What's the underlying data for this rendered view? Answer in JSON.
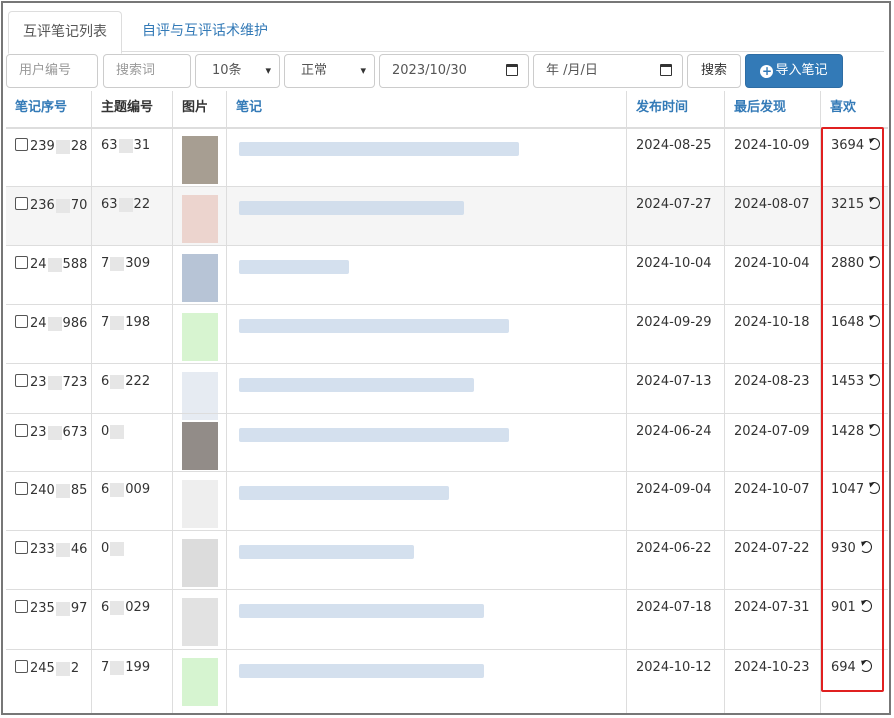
{
  "tabs": [
    {
      "label": "互评笔记列表",
      "active": true
    },
    {
      "label": "自评与互评话术维护",
      "active": false
    }
  ],
  "filters": {
    "user_id_placeholder": "用户编号",
    "keyword_placeholder": "搜索词",
    "page_size": "10条",
    "status": "正常",
    "date_from": "2023/10/30",
    "date_to_placeholder": "年 /月/日",
    "search_label": "搜索",
    "import_label": "导入笔记"
  },
  "columns": [
    "笔记序号",
    "主题编号",
    "图片",
    "笔记",
    "发布时间",
    "最后发现",
    "喜欢"
  ],
  "rows": [
    {
      "id_a": "239",
      "id_b": "28",
      "topic_a": "63",
      "topic_b": "31",
      "published": "2024-08-25",
      "last_seen": "2024-10-09",
      "likes": "3694",
      "thumb": "#8a7d6e",
      "note_w": 280
    },
    {
      "id_a": "236",
      "id_b": "70",
      "topic_a": "63",
      "topic_b": "22",
      "published": "2024-07-27",
      "last_seen": "2024-08-07",
      "likes": "3215",
      "thumb": "#e8c8c0",
      "note_w": 225
    },
    {
      "id_a": "24",
      "id_b": "588",
      "topic_a": "7",
      "topic_b": "309",
      "published": "2024-10-04",
      "last_seen": "2024-10-04",
      "likes": "2880",
      "thumb": "#9fb0c8",
      "note_w": 110
    },
    {
      "id_a": "24",
      "id_b": "986",
      "topic_a": "7",
      "topic_b": "198",
      "published": "2024-09-29",
      "last_seen": "2024-10-18",
      "likes": "1648",
      "thumb": "#c9f0c0",
      "note_w": 270
    },
    {
      "id_a": "23",
      "id_b": "723",
      "topic_a": "6",
      "topic_b": "222",
      "published": "2024-07-13",
      "last_seen": "2024-08-23",
      "likes": "1453",
      "thumb": "#dde4ee",
      "note_w": 235
    },
    {
      "id_a": "23",
      "id_b": "673",
      "topic_a": "0",
      "topic_b": "",
      "published": "2024-06-24",
      "last_seen": "2024-07-09",
      "likes": "1428",
      "thumb": "#6e6560",
      "note_w": 270
    },
    {
      "id_a": "240",
      "id_b": "85",
      "topic_a": "6",
      "topic_b": "009",
      "published": "2024-09-04",
      "last_seen": "2024-10-07",
      "likes": "1047",
      "thumb": "#e8e8e8",
      "note_w": 210
    },
    {
      "id_a": "233",
      "id_b": "46",
      "topic_a": "0",
      "topic_b": "",
      "published": "2024-06-22",
      "last_seen": "2024-07-22",
      "likes": "930",
      "thumb": "#d0d0d0",
      "note_w": 175
    },
    {
      "id_a": "235",
      "id_b": "97",
      "topic_a": "6",
      "topic_b": "029",
      "published": "2024-07-18",
      "last_seen": "2024-07-31",
      "likes": "901",
      "thumb": "#d8d8d8",
      "note_w": 245
    },
    {
      "id_a": "245",
      "id_b": "2",
      "topic_a": "7",
      "topic_b": "199",
      "published": "2024-10-12",
      "last_seen": "2024-10-23",
      "likes": "694",
      "thumb": "#c8f0c0",
      "note_w": 245
    }
  ]
}
